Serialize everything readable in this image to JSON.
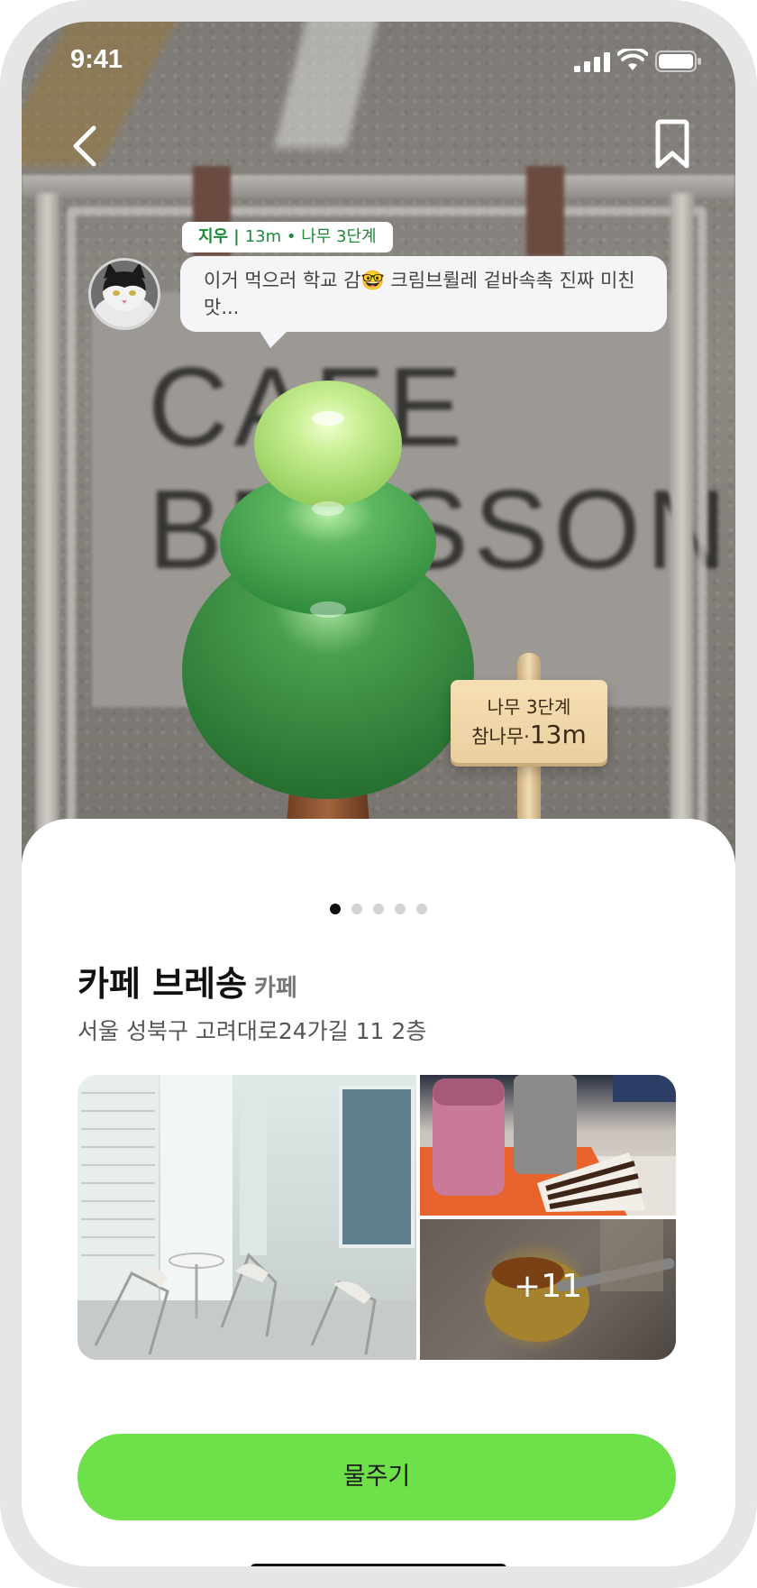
{
  "status_bar": {
    "time": "9:41"
  },
  "background": {
    "sign_text": "CAFE\nBRESSON"
  },
  "comment": {
    "author": "지우",
    "separator": "|",
    "meta": "13m • 나무 3단계",
    "text": "이거 먹으러 학교 감🤓 크림브륄레 겉바속촉 진짜 미친 맛..."
  },
  "signpost": {
    "line1": "나무 3단계",
    "line2_prefix": "참나무·",
    "distance": "13m"
  },
  "pager": {
    "count": 5,
    "active_index": 0
  },
  "place": {
    "name": "카페 브레송",
    "category": "카페",
    "address": "서울 성북구 고려대로24가길 11 2층"
  },
  "gallery": {
    "more_count": "+11"
  },
  "cta": {
    "label": "물주기"
  },
  "colors": {
    "accent_green": "#6ee04a",
    "tag_green": "#1f8a3a"
  }
}
